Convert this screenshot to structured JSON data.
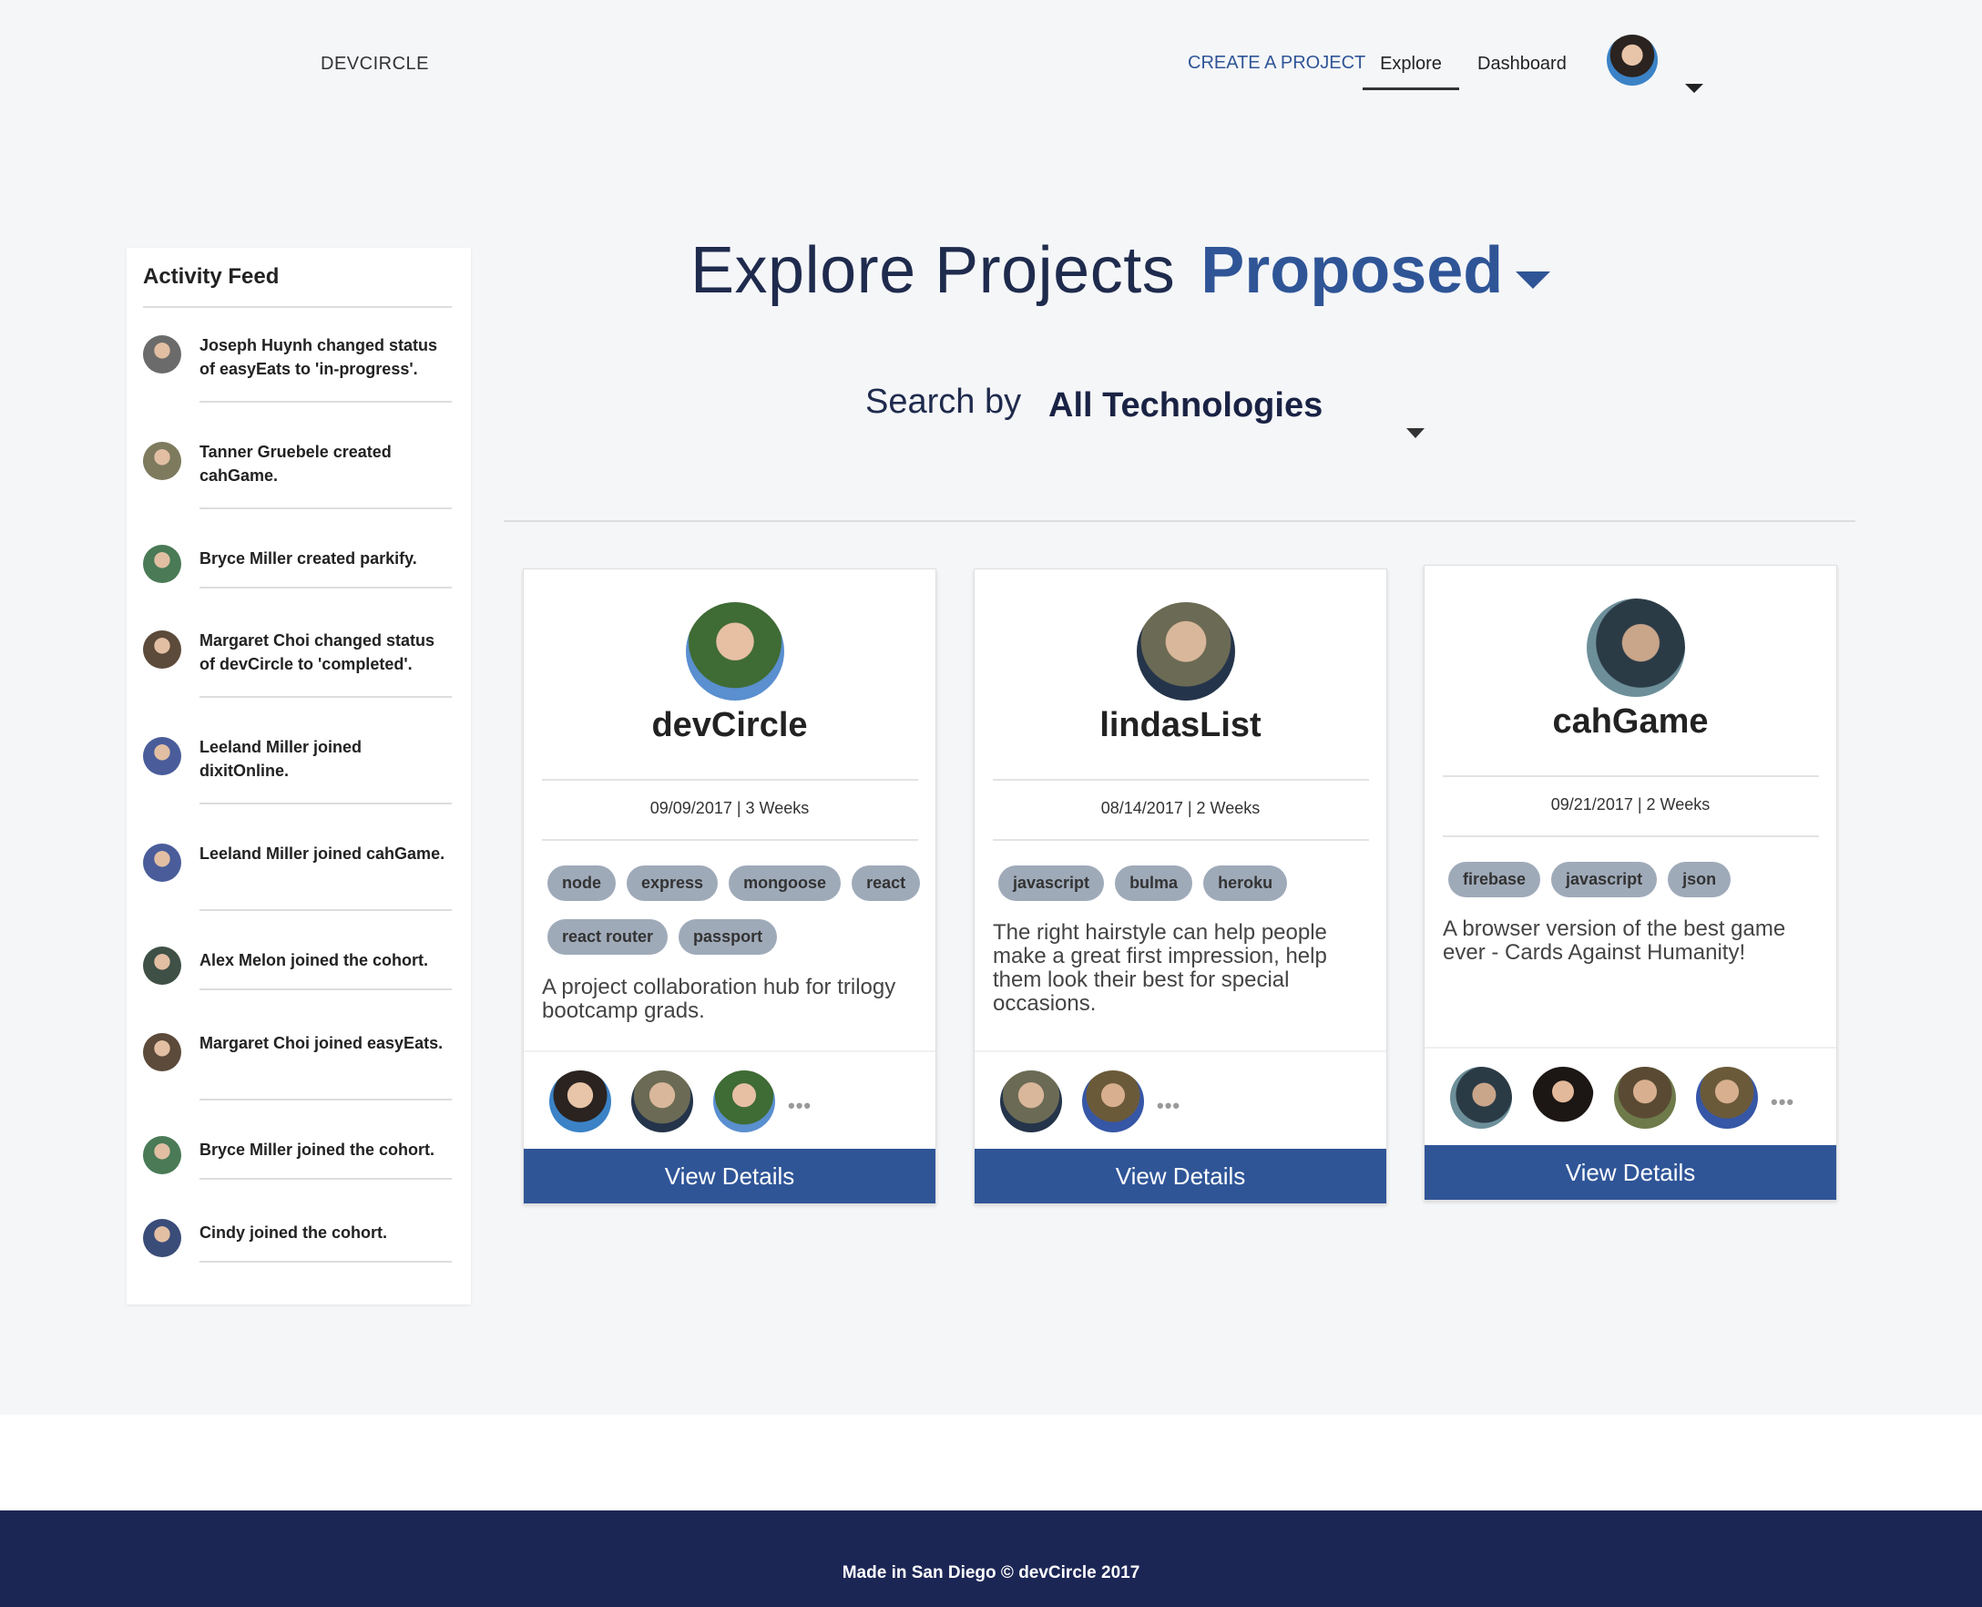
{
  "nav": {
    "brand": "DEVCIRCLE",
    "create": "CREATE A PROJECT",
    "explore": "Explore",
    "dashboard": "Dashboard"
  },
  "sidebar": {
    "title": "Activity Feed",
    "items": [
      {
        "text": "Joseph Huynh changed status of easyEats to 'in-progress'.",
        "color": "#6b6b6b"
      },
      {
        "text": "Tanner Gruebele created cahGame.",
        "color": "#7d7a5e"
      },
      {
        "text": "Bryce Miller created parkify.",
        "color": "#4a7a56"
      },
      {
        "text": "Margaret Choi changed status of devCircle to 'completed'.",
        "color": "#5c4a3a"
      },
      {
        "text": "Leeland Miller joined dixitOnline.",
        "color": "#4a5d9a"
      },
      {
        "text": "Leeland Miller joined cahGame.",
        "color": "#4a5d9a"
      },
      {
        "text": "Alex Melon joined the cohort.",
        "color": "#3f5046"
      },
      {
        "text": "Margaret Choi joined easyEats.",
        "color": "#5c4a3a"
      },
      {
        "text": "Bryce Miller joined the cohort.",
        "color": "#4a7a56"
      },
      {
        "text": "Cindy joined the cohort.",
        "color": "#3a4c78"
      }
    ]
  },
  "main": {
    "heading": "Explore Projects",
    "status": "Proposed",
    "search_label": "Search by",
    "search_value": "All Technologies"
  },
  "cards": [
    {
      "title": "devCircle",
      "meta": "09/09/2017 | 3 Weeks",
      "tags": [
        "node",
        "express",
        "mongoose",
        "react",
        "react router",
        "passport"
      ],
      "description": "A project collaboration hub for trilogy bootcamp grads.",
      "button": "View Details",
      "more": "•••"
    },
    {
      "title": "lindasList",
      "meta": "08/14/2017 | 2 Weeks",
      "tags": [
        "javascript",
        "bulma",
        "heroku"
      ],
      "description": "The right hairstyle can help people make a great first impression, help them look their best for special occasions.",
      "button": "View Details",
      "more": "•••"
    },
    {
      "title": "cahGame",
      "meta": "09/21/2017 | 2 Weeks",
      "tags": [
        "firebase",
        "javascript",
        "json"
      ],
      "description": "A browser version of the best game ever - Cards Against Humanity!",
      "button": "View Details",
      "more": "•••"
    }
  ],
  "footer": {
    "text": "Made in San Diego © devCircle 2017"
  },
  "colors": {
    "accent": "#2f5597",
    "footer": "#1c2655",
    "tag": "#9faab9"
  }
}
